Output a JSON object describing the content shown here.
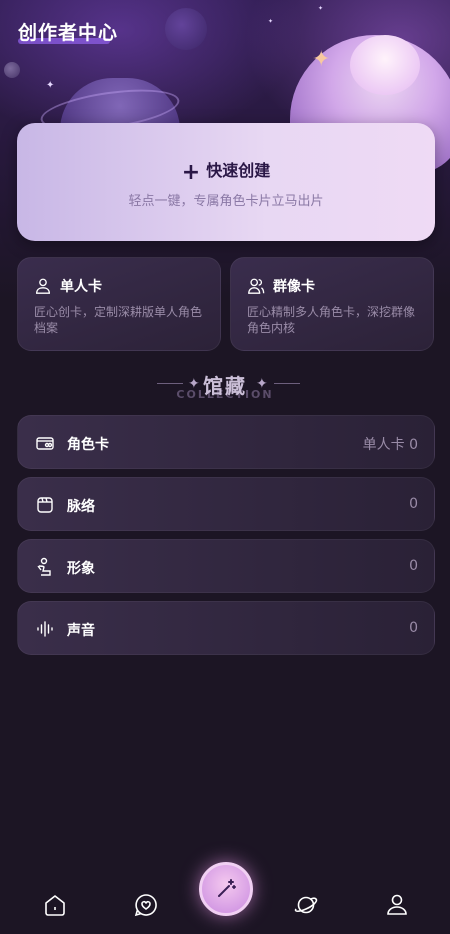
{
  "header": {
    "title": "创作者中心"
  },
  "quick_create": {
    "title": "快速创建",
    "subtitle": "轻点一键，专属角色卡片立马出片"
  },
  "cards": [
    {
      "title": "单人卡",
      "desc": "匠心创卡，定制深耕版单人角色档案",
      "icon": "person-icon"
    },
    {
      "title": "群像卡",
      "desc": "匠心精制多人角色卡，深挖群像角色内核",
      "icon": "group-icon"
    }
  ],
  "collection": {
    "title": "馆藏",
    "subtitle": "COLLECTION"
  },
  "rows": [
    {
      "label": "角色卡",
      "value": "单人卡 0",
      "icon": "card-icon"
    },
    {
      "label": "脉络",
      "value": "0",
      "icon": "book-icon"
    },
    {
      "label": "形象",
      "value": "0",
      "icon": "figure-icon"
    },
    {
      "label": "声音",
      "value": "0",
      "icon": "waveform-icon"
    }
  ],
  "tabbar": {
    "items": [
      "home-icon",
      "chat-icon",
      "create-wand-icon",
      "planet-icon",
      "profile-icon"
    ]
  },
  "colors": {
    "accent": "#c98be0",
    "background": "#1c1524",
    "card_light": "#e8d8f3"
  }
}
